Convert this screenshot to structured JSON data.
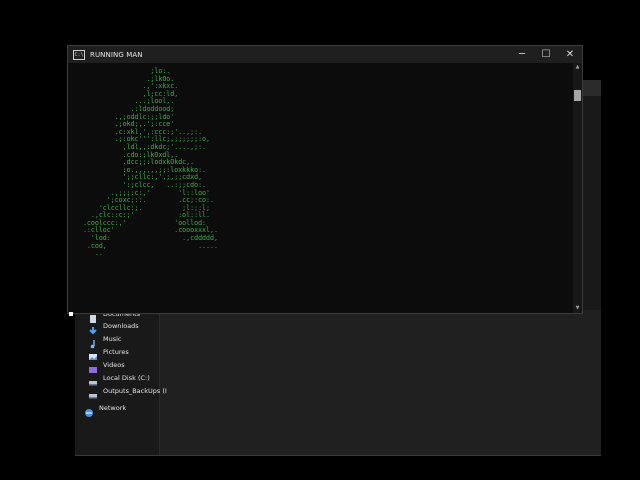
{
  "terminal": {
    "title": "RUNNING MAN",
    "icon_label": "C:\\",
    "controls": {
      "minimize": "─",
      "maximize": "☐",
      "close": "✕"
    },
    "ascii_art": "                   ;lo:.\n                  .;lkOo.\n                 .,':xkxc.\n                 ,l;cc:ld,\n               ...;lool,.\n              .:ldoddood;\n          .,;oddlc:;;ldo'\n          .;okd;,.';:cce'\n          .c:xkl,',:ccc:;'..,;:.\n          .;:okc''':llc;,;;;;;;:o,\n            ,ldl,,:dkdc;'....,;:.\n            .cdo:;lkOxdl,.\n            .dcc;;:lodxkOkdc,.\n            :o.,,,,,,;;:loxkkko:.\n            ';;cllc:,',;,;;cdxd,\n            ':;clcc,   ..:;;cdo:.\n         .,;;;:c:,'       'l::loo'\n        ';coxc;::.        .cc;:co:.\n      'clccllc:;.          ;l:;:l;\n    .,clc::c:;'           :ol::ll.\n  .coolccc:,'            'oollod:\n  .:clloc'               .coooxxxl,.\n    'lod:                  .,cddddd,\n   .cod,                       .....\n     .."
  },
  "explorer": {
    "nav_items": [
      {
        "label": "Documents",
        "icon": "documents-icon"
      },
      {
        "label": "Downloads",
        "icon": "downloads-icon"
      },
      {
        "label": "Music",
        "icon": "music-icon"
      },
      {
        "label": "Pictures",
        "icon": "pictures-icon"
      },
      {
        "label": "Videos",
        "icon": "videos-icon"
      },
      {
        "label": "Local Disk (C:)",
        "icon": "drive-icon"
      },
      {
        "label": "Outputs_BackUps (I",
        "icon": "drive-icon"
      },
      {
        "label": "Network",
        "icon": "network-icon"
      }
    ]
  },
  "colors": {
    "terminal_text": "#3bb54a",
    "terminal_bg": "#0c0c0c",
    "explorer_bg": "#191919"
  }
}
